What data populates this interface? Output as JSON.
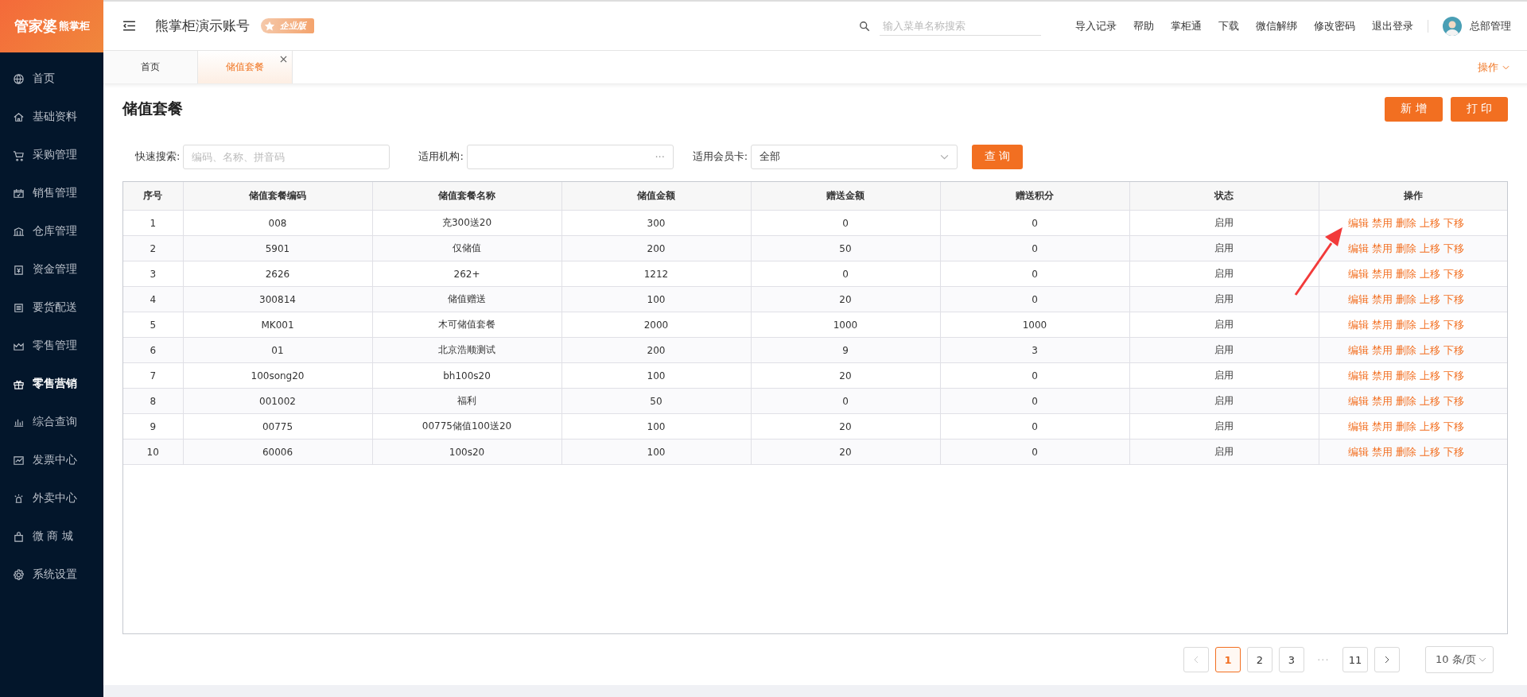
{
  "logo": {
    "main": "管家婆",
    "sub": "熊掌柜"
  },
  "sidebar": {
    "items": [
      {
        "label": "首页",
        "selected": false
      },
      {
        "label": "基础资料",
        "selected": false
      },
      {
        "label": "采购管理",
        "selected": false
      },
      {
        "label": "销售管理",
        "selected": false
      },
      {
        "label": "仓库管理",
        "selected": false
      },
      {
        "label": "资金管理",
        "selected": false
      },
      {
        "label": "要货配送",
        "selected": false
      },
      {
        "label": "零售管理",
        "selected": false
      },
      {
        "label": "零售营销",
        "selected": true
      },
      {
        "label": "综合查询",
        "selected": false
      },
      {
        "label": "发票中心",
        "selected": false
      },
      {
        "label": "外卖中心",
        "selected": false
      },
      {
        "label": "微 商 城",
        "selected": false
      },
      {
        "label": "系统设置",
        "selected": false
      }
    ]
  },
  "header": {
    "account": "熊掌柜演示账号",
    "edition": "企业版",
    "search": {
      "placeholder": "输入菜单名称搜索"
    },
    "links": [
      "导入记录",
      "帮助",
      "掌柜通",
      "下载",
      "微信解绑",
      "修改密码",
      "退出登录"
    ],
    "user": "总部管理"
  },
  "tabs": [
    {
      "label": "首页",
      "selected": false,
      "closable": false
    },
    {
      "label": "储值套餐",
      "selected": true,
      "closable": true
    }
  ],
  "tab_actions": "操作",
  "page": {
    "title": "储值套餐",
    "buttons": [
      "新 增",
      "打 印"
    ]
  },
  "filters": {
    "quick_search": {
      "label": "快速搜索:",
      "placeholder": "编码、名称、拼音码"
    },
    "org": {
      "label": "适用机构:",
      "picker": "···"
    },
    "card": {
      "label": "适用会员卡:",
      "value": "全部"
    },
    "query_button": "查 询"
  },
  "table": {
    "columns": [
      "序号",
      "储值套餐编码",
      "储值套餐名称",
      "储值金额",
      "赠送金额",
      "赠送积分",
      "状态",
      "操作"
    ],
    "rows": [
      {
        "cells": [
          "1",
          "008",
          "充300送20",
          "300",
          "0",
          "0",
          "启用"
        ],
        "actions": [
          "编辑",
          "禁用",
          "删除",
          "上移",
          "下移"
        ]
      },
      {
        "cells": [
          "2",
          "5901",
          "仅储值",
          "200",
          "50",
          "0",
          "启用"
        ],
        "actions": [
          "编辑",
          "禁用",
          "删除",
          "上移",
          "下移"
        ]
      },
      {
        "cells": [
          "3",
          "2626",
          "262+",
          "1212",
          "0",
          "0",
          "启用"
        ],
        "actions": [
          "编辑",
          "禁用",
          "删除",
          "上移",
          "下移"
        ]
      },
      {
        "cells": [
          "4",
          "300814",
          "储值赠送",
          "100",
          "20",
          "0",
          "启用"
        ],
        "actions": [
          "编辑",
          "禁用",
          "删除",
          "上移",
          "下移"
        ]
      },
      {
        "cells": [
          "5",
          "MK001",
          "木可储值套餐",
          "2000",
          "1000",
          "1000",
          "启用"
        ],
        "actions": [
          "编辑",
          "禁用",
          "删除",
          "上移",
          "下移"
        ]
      },
      {
        "cells": [
          "6",
          "01",
          "北京浩顺测试",
          "200",
          "9",
          "3",
          "启用"
        ],
        "actions": [
          "编辑",
          "禁用",
          "删除",
          "上移",
          "下移"
        ]
      },
      {
        "cells": [
          "7",
          "100song20",
          "bh100s20",
          "100",
          "20",
          "0",
          "启用"
        ],
        "actions": [
          "编辑",
          "禁用",
          "删除",
          "上移",
          "下移"
        ]
      },
      {
        "cells": [
          "8",
          "001002",
          "福利",
          "50",
          "0",
          "0",
          "启用"
        ],
        "actions": [
          "编辑",
          "禁用",
          "删除",
          "上移",
          "下移"
        ]
      },
      {
        "cells": [
          "9",
          "00775",
          "00775储值100送20",
          "100",
          "20",
          "0",
          "启用"
        ],
        "actions": [
          "编辑",
          "禁用",
          "删除",
          "上移",
          "下移"
        ]
      },
      {
        "cells": [
          "10",
          "60006",
          "100s20",
          "100",
          "20",
          "0",
          "启用"
        ],
        "actions": [
          "编辑",
          "禁用",
          "删除",
          "上移",
          "下移"
        ]
      }
    ]
  },
  "pagination": {
    "pages": [
      {
        "label": "1",
        "selected": true
      },
      {
        "label": "2",
        "selected": false
      },
      {
        "label": "3",
        "selected": false
      },
      {
        "label": "···",
        "kind": "ellipsis"
      },
      {
        "label": "11",
        "selected": false
      }
    ],
    "page_size": "10 条/页"
  }
}
